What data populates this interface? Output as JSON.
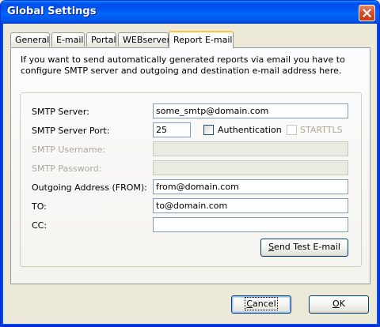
{
  "window": {
    "title": "Global Settings"
  },
  "tabs": [
    {
      "label": "General",
      "active": false
    },
    {
      "label": "E-mail",
      "active": false
    },
    {
      "label": "Portal",
      "active": false
    },
    {
      "label": "WEBserver",
      "active": false
    },
    {
      "label": "Report E-mail",
      "active": true
    }
  ],
  "intro": "If you want to send automatically generated reports via email you have to configure SMTP server and outgoing and destination e-mail address here.",
  "form": {
    "smtp_server": {
      "label": "SMTP Server:",
      "value": "some_smtp@domain.com"
    },
    "smtp_port": {
      "label": "SMTP Server Port:",
      "value": "25"
    },
    "authentication": {
      "label": "Authentication",
      "checked": false
    },
    "starttls": {
      "label": "STARTTLS",
      "checked": false,
      "enabled": false
    },
    "smtp_username": {
      "label": "SMTP Username:",
      "value": "",
      "enabled": false
    },
    "smtp_password": {
      "label": "SMTP Password:",
      "value": "",
      "enabled": false
    },
    "from": {
      "label": "Outgoing Address (FROM):",
      "value": "from@domain.com"
    },
    "to": {
      "label": "TO:",
      "value": "to@domain.com"
    },
    "cc": {
      "label": "CC:",
      "value": ""
    },
    "send_test": {
      "label_pre": "",
      "label_u": "S",
      "label_post": "end Test E-mail"
    }
  },
  "buttons": {
    "cancel": {
      "label_u": "C",
      "label_post": "ancel"
    },
    "ok": {
      "label_u": "O",
      "label_post": "K"
    }
  },
  "colors": {
    "titlebar": "#0054e3",
    "focus_border": "#ffc83c",
    "dialog_bg": "#ece9d8"
  },
  "icons": {
    "close": "close-icon"
  }
}
